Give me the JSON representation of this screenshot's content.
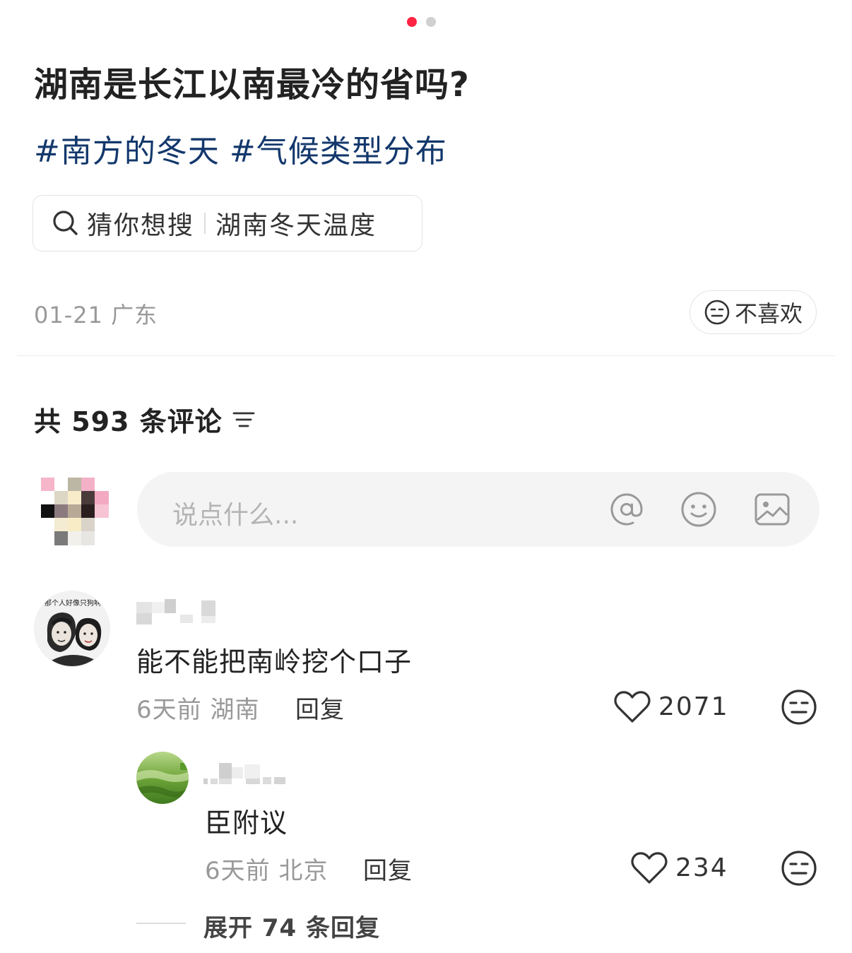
{
  "pager": {
    "total": 2,
    "active": 1
  },
  "post": {
    "title": "湖南是长江以南最冷的省吗?",
    "tags": [
      "#南方的冬天",
      "#气候类型分布"
    ],
    "suggest": {
      "prefix": "猜你想搜",
      "query": "湖南冬天温度"
    },
    "meta": "01-21 广东",
    "dislike_label": "不喜欢"
  },
  "comments_header": {
    "count_text": "共 593 条评论"
  },
  "input": {
    "placeholder": "说点什么..."
  },
  "comments": [
    {
      "text": "能不能把南岭挖个口子",
      "meta": "6天前 湖南",
      "reply_label": "回复",
      "likes": "2071",
      "avatar_caption": "那个人好像只狗啊"
    }
  ],
  "replies": [
    {
      "text": "臣附议",
      "meta": "6天前 北京",
      "reply_label": "回复",
      "likes": "234"
    }
  ],
  "expand": {
    "label": "展开 74 条回复"
  },
  "colors": {
    "accent": "#ff2442",
    "tag": "#13386c",
    "muted": "#999999"
  },
  "icons": [
    "search-icon",
    "neutral-face-icon",
    "sort-icon",
    "at-icon",
    "smiley-icon",
    "image-icon",
    "heart-icon"
  ]
}
